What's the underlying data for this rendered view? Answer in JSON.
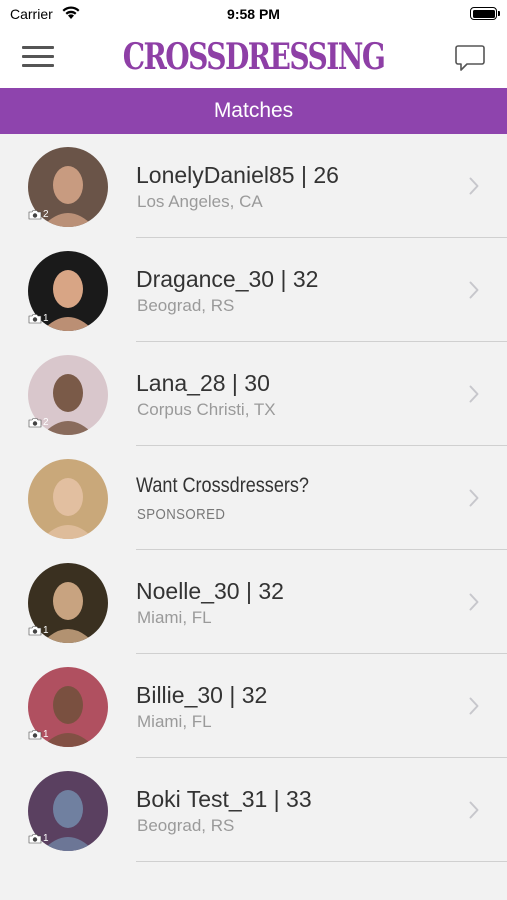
{
  "status_bar": {
    "carrier": "Carrier",
    "time": "9:58 PM"
  },
  "nav": {
    "logo": "CROSSDRESSING",
    "menu_icon": "hamburger-menu-icon",
    "chat_icon": "chat-bubble-icon"
  },
  "header": {
    "title": "Matches"
  },
  "colors": {
    "brand_purple": "#8e44ad",
    "logo_purple": "#8e3fa6"
  },
  "matches": [
    {
      "name": "LonelyDaniel85 | 26",
      "location": "Los Angeles, CA",
      "photos": "2",
      "avatar_bg": "#6a5448",
      "avatar_fg": "#c89b80"
    },
    {
      "name": "Dragance_30 | 32",
      "location": "Beograd, RS",
      "photos": "1",
      "avatar_bg": "#1a1a1a",
      "avatar_fg": "#d8a585"
    },
    {
      "name": "Lana_28 | 30",
      "location": "Corpus Christi, TX",
      "photos": "2",
      "avatar_bg": "#d9c7cc",
      "avatar_fg": "#7a5a48"
    },
    {
      "name": "Want Crossdressers?",
      "location": "SPONSORED",
      "photos": "",
      "sponsored": true,
      "avatar_bg": "#c9a87a",
      "avatar_fg": "#e2bfa0"
    },
    {
      "name": "Noelle_30 | 32",
      "location": "Miami, FL",
      "photos": "1",
      "avatar_bg": "#3a3020",
      "avatar_fg": "#c8a380"
    },
    {
      "name": "Billie_30 | 32",
      "location": "Miami, FL",
      "photos": "1",
      "avatar_bg": "#b05060",
      "avatar_fg": "#7a5040"
    },
    {
      "name": "Boki Test_31 | 33",
      "location": "Beograd, RS",
      "photos": "1",
      "avatar_bg": "#5a4060",
      "avatar_fg": "#7080a0"
    }
  ]
}
